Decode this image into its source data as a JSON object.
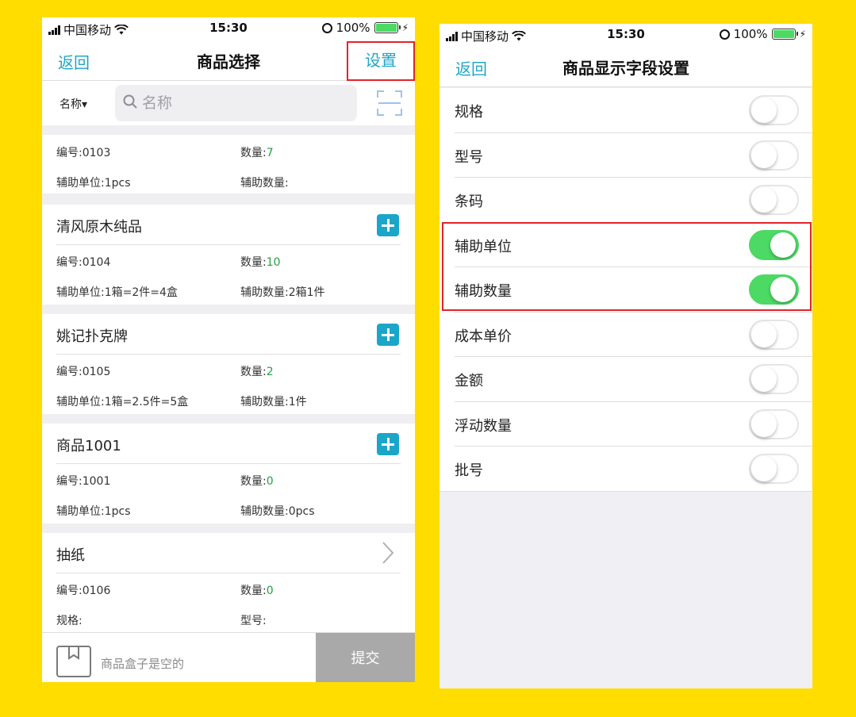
{
  "colors": {
    "background": "#FFDD00",
    "accent": "#22a5c5",
    "highlight": "#e0242a",
    "toggle_on": "#4cd964",
    "quantity": "#22a240"
  },
  "left": {
    "status": {
      "carrier": "中国移动",
      "time": "15:30",
      "battery": "100%"
    },
    "nav": {
      "back": "返回",
      "title": "商品选择",
      "settings": "设置"
    },
    "search": {
      "filter_label": "名称▾",
      "placeholder": "名称"
    },
    "labels": {
      "code": "编号:",
      "qty": "数量:",
      "aux_unit": "辅助单位:",
      "aux_qty": "辅助数量:",
      "spec": "规格:",
      "model": "型号:"
    },
    "products": [
      {
        "name": "",
        "code": "0103",
        "qty": "7",
        "aux_unit": "1pcs",
        "aux_qty": ""
      },
      {
        "name": "清风原木纯品",
        "code": "0104",
        "qty": "10",
        "aux_unit": "1箱=2件=4盒",
        "aux_qty": "2箱1件"
      },
      {
        "name": "姚记扑克牌",
        "code": "0105",
        "qty": "2",
        "aux_unit": "1箱=2.5件=5盒",
        "aux_qty": "1件"
      },
      {
        "name": "商品1001",
        "code": "1001",
        "qty": "0",
        "aux_unit": "1pcs",
        "aux_qty": "0pcs"
      },
      {
        "name": "抽纸",
        "code": "0106",
        "qty": "0",
        "spec": "",
        "model": ""
      }
    ],
    "bottom": {
      "empty_text": "商品盒子是空的",
      "submit": "提交"
    }
  },
  "right": {
    "status": {
      "carrier": "中国移动",
      "time": "15:30",
      "battery": "100%"
    },
    "nav": {
      "back": "返回",
      "title": "商品显示字段设置"
    },
    "fields": [
      {
        "label": "规格",
        "on": false
      },
      {
        "label": "型号",
        "on": false
      },
      {
        "label": "条码",
        "on": false
      },
      {
        "label": "辅助单位",
        "on": true
      },
      {
        "label": "辅助数量",
        "on": true
      },
      {
        "label": "成本单价",
        "on": false
      },
      {
        "label": "金额",
        "on": false
      },
      {
        "label": "浮动数量",
        "on": false
      },
      {
        "label": "批号",
        "on": false
      }
    ]
  }
}
